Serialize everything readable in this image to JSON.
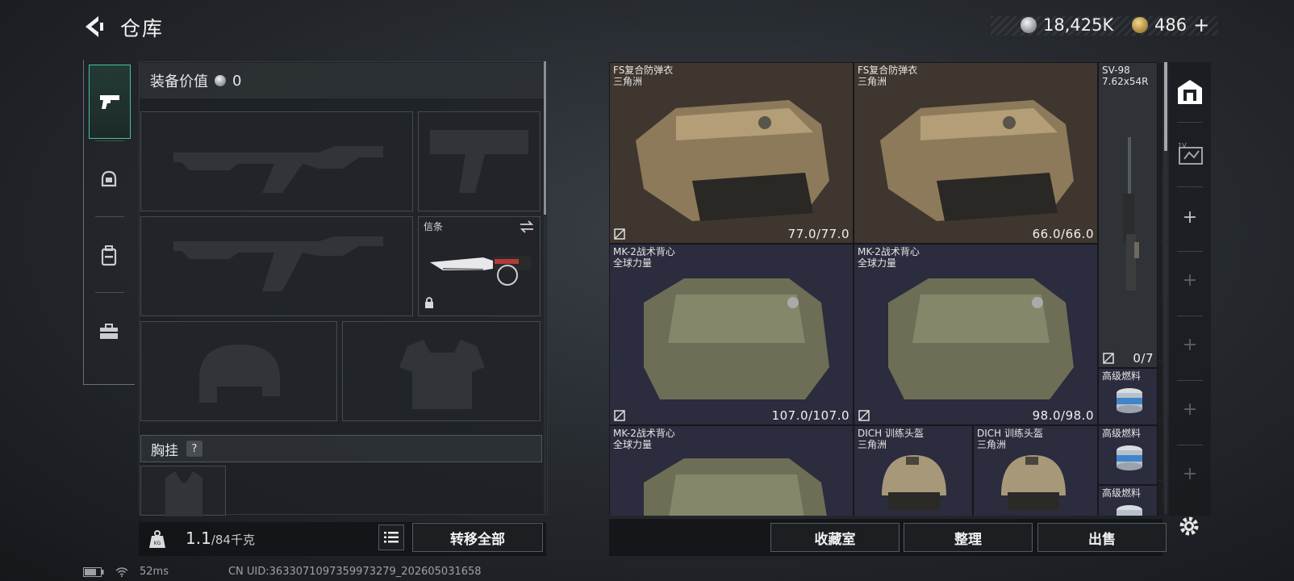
{
  "header": {
    "title": "仓库",
    "currency_silver": "18,425K",
    "currency_gold": "486",
    "currency_gold_add": "+"
  },
  "left_tabs": [
    "pistol-icon",
    "helmet-icon",
    "backpack-icon",
    "toolbox-icon"
  ],
  "loadout": {
    "value_label": "装备价值",
    "value_amount": "0",
    "melee_slot_label": "信条",
    "chest_rig_label": "胸挂",
    "chest_rig_help": "?",
    "weight_current": "1.1",
    "weight_max": "/84千克",
    "transfer_all_label": "转移全部"
  },
  "stash": {
    "items": [
      {
        "name": "FS复合防弹衣",
        "sub": "三角洲",
        "durability": "77.0/77.0"
      },
      {
        "name": "FS复合防弹衣",
        "sub": "三角洲",
        "durability": "66.0/66.0"
      },
      {
        "name": "SV-98",
        "sub": "7.62x54R",
        "durability": "0/7"
      },
      {
        "name": "MK-2战术背心",
        "sub": "全球力量",
        "durability": "107.0/107.0"
      },
      {
        "name": "MK-2战术背心",
        "sub": "全球力量",
        "durability": "98.0/98.0"
      },
      {
        "name": "高级燃料",
        "sub": "",
        "durability": ""
      },
      {
        "name": "MK-2战术背心",
        "sub": "全球力量",
        "durability": ""
      },
      {
        "name": "DICH 训练头盔",
        "sub": "三角洲",
        "durability": ""
      },
      {
        "name": "DICH 训练头盔",
        "sub": "三角洲",
        "durability": ""
      },
      {
        "name": "高级燃料",
        "sub": "",
        "durability": ""
      },
      {
        "name": "高级燃料",
        "sub": "",
        "durability": ""
      }
    ]
  },
  "right_nav": {
    "plus": [
      "+",
      "+",
      "+",
      "+",
      "+"
    ]
  },
  "actions": {
    "collection_label": "收藏室",
    "sort_label": "整理",
    "sell_label": "出售"
  },
  "status": {
    "ping": "52ms",
    "uid": "CN UID:3633071097359973279_202605031658"
  },
  "colors": {
    "accent": "#47c29a",
    "brown_cell": "#3f362f",
    "blue_cell": "#2b2c3d"
  }
}
